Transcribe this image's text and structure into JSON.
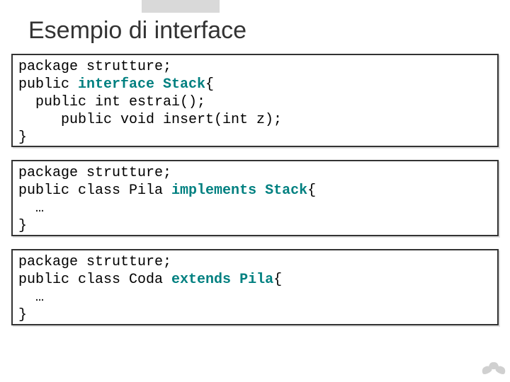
{
  "title": "Esempio di interface",
  "box1": {
    "l1a": "package strutture;",
    "l2a": "public ",
    "l2b": "interface Stack",
    "l2c": "{",
    "l3a": "  public int estrai();",
    "l4a": "     public void insert(int z);",
    "l5a": "}"
  },
  "box2": {
    "l1a": "package strutture;",
    "l2a": "public class Pila ",
    "l2b": "implements Stack",
    "l2c": "{",
    "l3a": "  …",
    "l4a": "}"
  },
  "box3": {
    "l1a": "package strutture;",
    "l2a": "public class Coda ",
    "l2b": "extends Pila",
    "l2c": "{",
    "l3a": "  …",
    "l4a": "}"
  }
}
